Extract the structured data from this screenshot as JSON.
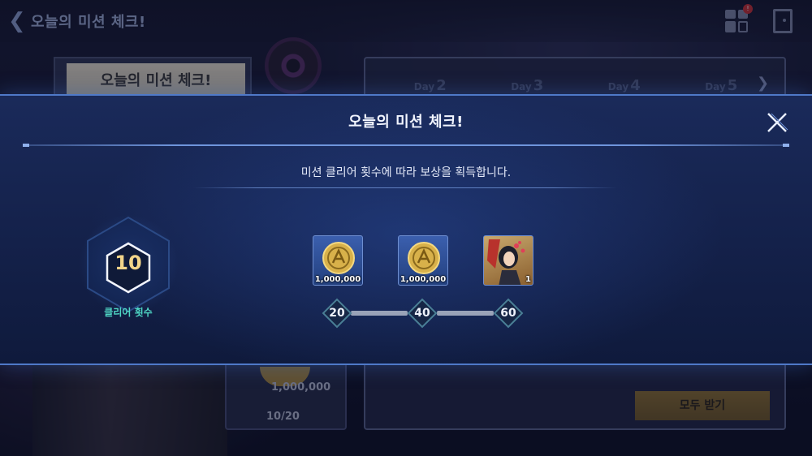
{
  "header": {
    "title": "오늘의 미션 체크!",
    "back_icon": "chevron-left-icon",
    "menu_icon": "grid-menu-icon",
    "notification_badge": "!",
    "exit_icon": "door-exit-icon"
  },
  "background": {
    "card_title": "오늘의 미션 체크!",
    "days": [
      {
        "prefix": "Day",
        "num": "2"
      },
      {
        "prefix": "Day",
        "num": "3"
      },
      {
        "prefix": "Day",
        "num": "4"
      },
      {
        "prefix": "Day",
        "num": "5"
      }
    ],
    "coin_amount": "1,000,000",
    "progress": "10/20",
    "claim_all_label": "모두 받기"
  },
  "modal": {
    "title": "오늘의 미션 체크!",
    "description": "미션 클리어 횟수에 따라 보상을 획득합니다.",
    "close_icon": "close-icon",
    "clear_count": "10",
    "clear_label": "클리어 횟수",
    "rewards": [
      {
        "type": "coin",
        "icon": "gold-coin-icon",
        "quantity": "1,000,000",
        "milestone": "20"
      },
      {
        "type": "coin",
        "icon": "gold-coin-icon",
        "quantity": "1,000,000",
        "milestone": "40"
      },
      {
        "type": "character",
        "icon": "character-portrait-icon",
        "quantity": "1",
        "milestone": "60"
      }
    ]
  },
  "colors": {
    "accent_blue": "#4f79c8",
    "coin_gold": "#d8b14a",
    "clear_label_teal": "#4fd6c4",
    "count_gold": "#f2d58a"
  }
}
